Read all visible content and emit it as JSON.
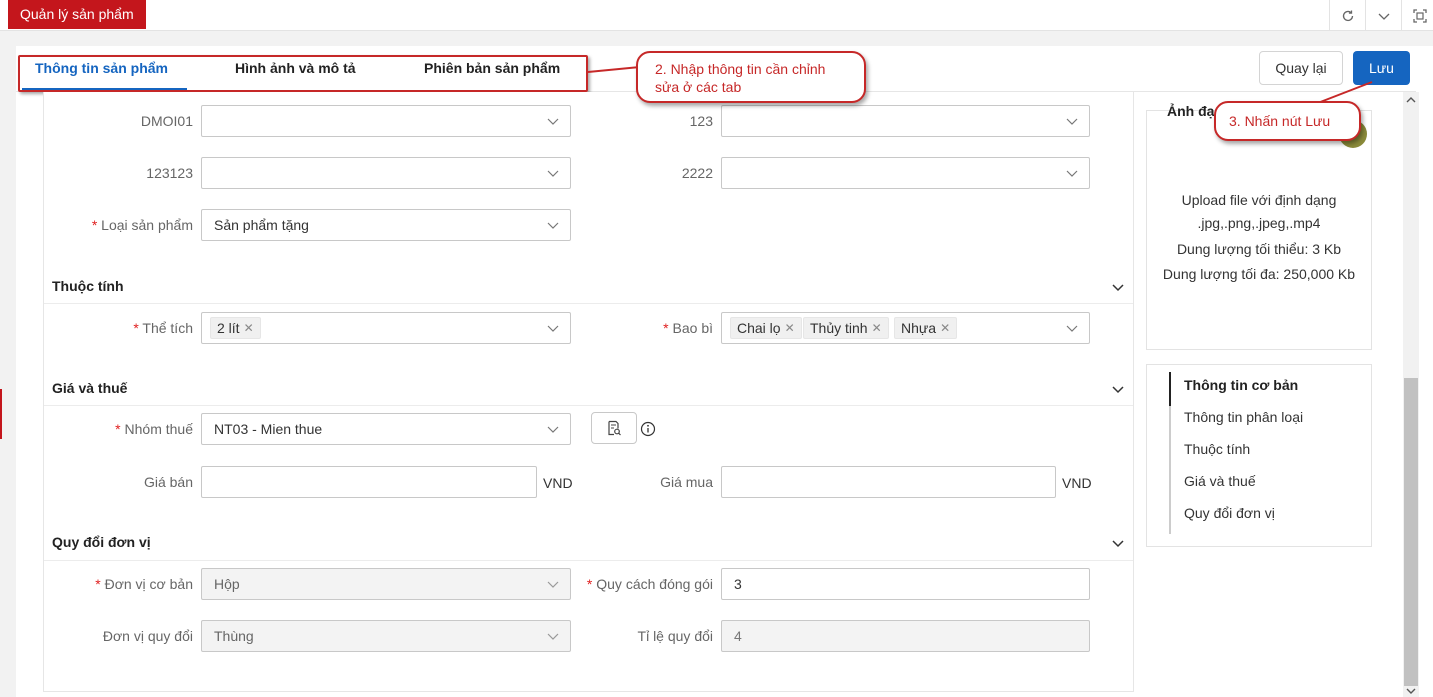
{
  "app_tab": {
    "label": "Quản lý sản phẩm"
  },
  "tabs": [
    {
      "label": "Thông tin sản phẩm",
      "active": true
    },
    {
      "label": "Hình ảnh và mô tả",
      "active": false
    },
    {
      "label": "Phiên bản sản phẩm",
      "active": false
    }
  ],
  "actions": {
    "back_label": "Quay lại",
    "save_label": "Lưu"
  },
  "callouts": {
    "step2_line1": "2. Nhập thông tin cần chỉnh",
    "step2_line2": "sửa ở các tab",
    "step3": "3. Nhấn nút Lưu"
  },
  "fields": {
    "dmoi01": {
      "label": "DMOI01",
      "value": ""
    },
    "f123": {
      "label": "123",
      "value": ""
    },
    "f123123": {
      "label": "123123",
      "value": ""
    },
    "f2222": {
      "label": "2222",
      "value": ""
    },
    "product_type": {
      "label": "Loại sản phẩm",
      "value": "Sản phẩm tặng",
      "required": true
    }
  },
  "sections": {
    "attributes": {
      "title": "Thuộc tính",
      "volume": {
        "label": "Thể tích",
        "tags": [
          "2 lít"
        ],
        "required": true
      },
      "packaging": {
        "label": "Bao bì",
        "tags": [
          "Chai lọ",
          "Thủy tinh",
          "Nhựa"
        ],
        "required": true
      }
    },
    "price_tax": {
      "title": "Giá và thuế",
      "tax_group": {
        "label": "Nhóm thuế",
        "value": "NT03 - Mien thue",
        "required": true
      },
      "sell_price": {
        "label": "Giá bán",
        "value": "",
        "unit": "VND"
      },
      "buy_price": {
        "label": "Giá mua",
        "value": "",
        "unit": "VND"
      }
    },
    "unit_conversion": {
      "title": "Quy đổi đơn vị",
      "base_unit": {
        "label": "Đơn vị cơ bản",
        "value": "Hộp",
        "required": true
      },
      "packing_spec": {
        "label": "Quy cách đóng gói",
        "value": "3",
        "required": true
      },
      "conv_unit": {
        "label": "Đơn vị quy đổi",
        "value": "Thùng"
      },
      "conv_ratio": {
        "label": "Tỉ lệ quy đổi",
        "value": "4"
      }
    }
  },
  "image_card": {
    "title_partial": "Ảnh đạ",
    "upload_line1": "Upload file với định dạng",
    "upload_line2": ".jpg,.png,.jpeg,.mp4",
    "min_size": "Dung lượng tối thiểu: 3 Kb",
    "max_size": "Dung lượng tối đa: 250,000 Kb"
  },
  "side_nav": [
    {
      "label": "Thông tin cơ bản",
      "active": true
    },
    {
      "label": "Thông tin phân loại"
    },
    {
      "label": "Thuộc tính"
    },
    {
      "label": "Giá và thuế"
    },
    {
      "label": "Quy đổi đơn vị"
    }
  ],
  "colors": {
    "brand_red": "#c4161c",
    "primary_blue": "#1565c0",
    "required": "#e02020",
    "callout_red": "#c62828"
  }
}
